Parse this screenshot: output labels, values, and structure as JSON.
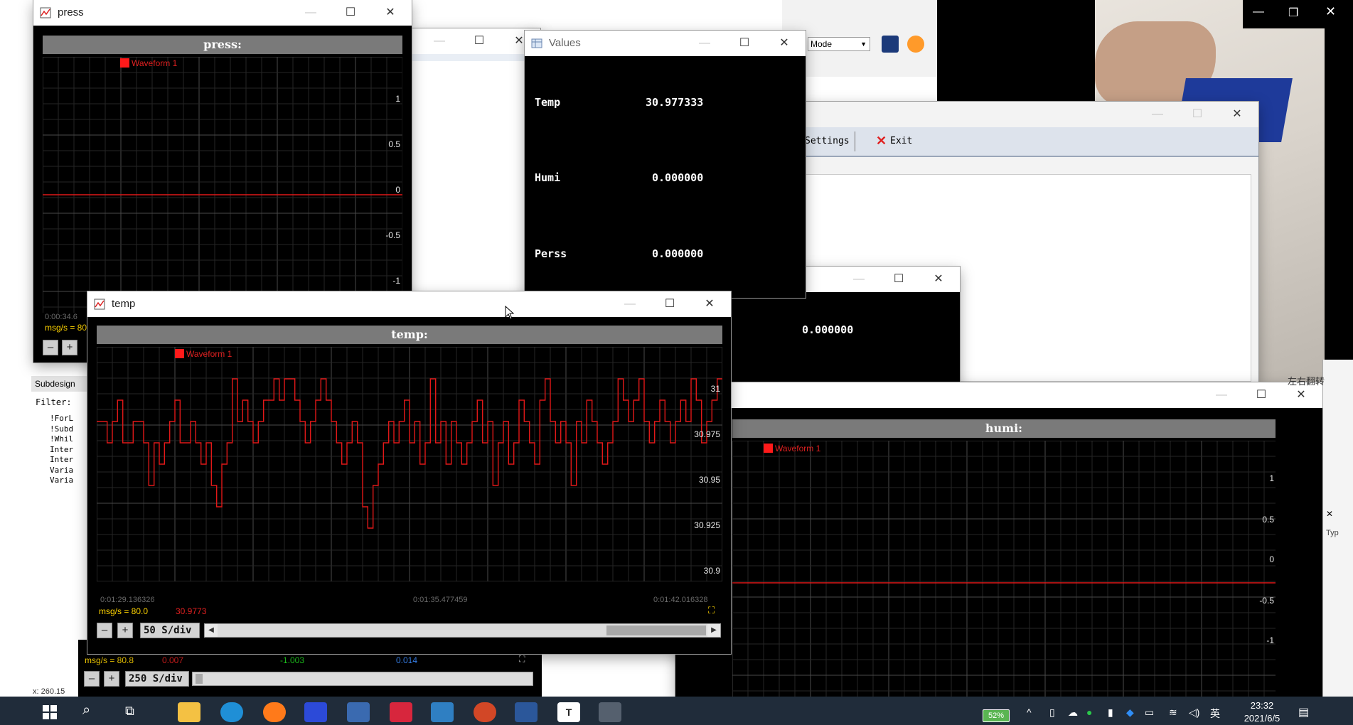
{
  "press_window": {
    "title": "press",
    "plot_title": "press:",
    "legend": "Waveform 1",
    "ticks": [
      "1",
      "0.5",
      "0",
      "-0.5",
      "-1"
    ],
    "timestamp": "0:00:34.6",
    "msg_rate": "msg/s = 80",
    "minus": "–",
    "plus": "+"
  },
  "values_window": {
    "title": "Values",
    "rows": [
      {
        "label": "Temp",
        "value": "30.977333"
      },
      {
        "label": "Humi",
        "value": "0.000000"
      },
      {
        "label": "Perss",
        "value": "0.000000"
      }
    ]
  },
  "temp_window": {
    "title": "temp",
    "plot_title": "temp:",
    "legend": "Waveform 1",
    "ticks": [
      "31",
      "30.975",
      "30.95",
      "30.925",
      "30.9"
    ],
    "time_left": "0:01:29.136326",
    "time_mid": "0:01:35.477459",
    "time_right": "0:01:42.016328",
    "msg_rate": "msg/s = 80.0",
    "current_value": "30.9773",
    "minus": "–",
    "plus": "+",
    "sdiv": "50 S/div"
  },
  "humi_window": {
    "plot_title": "humi:",
    "legend": "Waveform 1",
    "ticks": [
      "1",
      "0.5",
      "0",
      "-0.5",
      "-1"
    ]
  },
  "back_window": {
    "value": "0.000000"
  },
  "toolbar_window": {
    "mode_select": "Mode",
    "settings": "Settings",
    "exit": "Exit"
  },
  "left_panel": {
    "tab": "Subdesign",
    "filter_label": "Filter:",
    "items": [
      "!ForL",
      "!Subd",
      "!Whil",
      "Inter",
      "Inter",
      "Varia",
      "Varia"
    ],
    "coords": "x: 260.15"
  },
  "bottom_plot_bar": {
    "msg_rate": "msg/s = 80.8",
    "v1": "0.007",
    "v2": "-1.003",
    "v3": "0.014",
    "minus": "–",
    "plus": "+",
    "sdiv": "250 S/div"
  },
  "right_peek": {
    "text": "左右翻转",
    "typ": "Typ"
  },
  "taskbar": {
    "battery": "52%",
    "ime": "英",
    "time": "23:32",
    "date": "2021/6/5"
  },
  "colors": {
    "waveform": "#e01818",
    "plot_bg": "#000000",
    "grid": "#2a2a2a",
    "taskbar": "#202c3a"
  },
  "chart_data": [
    {
      "type": "line",
      "title": "temp:",
      "series": [
        {
          "name": "Waveform 1",
          "values": [
            30.965,
            30.965,
            30.955,
            30.965,
            30.975,
            30.955,
            30.955,
            30.965,
            30.965,
            30.955,
            30.935,
            30.955,
            30.945,
            30.955,
            30.965,
            30.975,
            30.955,
            30.955,
            30.965,
            30.955,
            30.945,
            30.955,
            30.935,
            30.925,
            30.945,
            30.955,
            30.985,
            30.965,
            30.975,
            30.965,
            30.955,
            30.965,
            30.975,
            30.975,
            30.985,
            30.975,
            30.985,
            30.985,
            30.975,
            30.965,
            30.955,
            30.965,
            30.975,
            30.985,
            30.975,
            30.965,
            30.955,
            30.945,
            30.955,
            30.965,
            30.955,
            30.925,
            30.915,
            30.935,
            30.945,
            30.955,
            30.965,
            30.955,
            30.965,
            30.975,
            30.955,
            30.965,
            30.945,
            30.955,
            30.985,
            30.955,
            30.965,
            30.945,
            30.965,
            30.955,
            30.945,
            30.955,
            30.965,
            30.975,
            30.955,
            30.965,
            30.935,
            30.955,
            30.965,
            30.945,
            30.955,
            30.975,
            30.965,
            30.955,
            30.945,
            30.975,
            30.985,
            30.965,
            30.955,
            30.965,
            30.955,
            30.935,
            30.965,
            30.955,
            30.975,
            30.965,
            30.955,
            30.945,
            30.955,
            30.965,
            30.985,
            30.975,
            30.965,
            30.975,
            30.985,
            30.965,
            30.955,
            30.965,
            30.975,
            30.965,
            30.955,
            30.965,
            30.975,
            30.965,
            30.985,
            30.975,
            30.955,
            30.965,
            30.975,
            30.985
          ]
        }
      ],
      "ylim": [
        30.89,
        31.0
      ],
      "y_ticks": [
        31,
        30.975,
        30.95,
        30.925,
        30.9
      ],
      "x_ticks": [
        "0:01:29.136326",
        "0:01:35.477459",
        "0:01:42.016328"
      ],
      "grid": true,
      "legend": "top-left"
    },
    {
      "type": "line",
      "title": "press:",
      "series": [
        {
          "name": "Waveform 1",
          "values": [
            0,
            0
          ]
        }
      ],
      "ylim": [
        -1,
        1
      ],
      "y_ticks": [
        1,
        0.5,
        0,
        -0.5,
        -1
      ],
      "grid": true
    },
    {
      "type": "line",
      "title": "humi:",
      "series": [
        {
          "name": "Waveform 1",
          "values": [
            0,
            0
          ]
        }
      ],
      "ylim": [
        -1,
        1
      ],
      "y_ticks": [
        1,
        0.5,
        0,
        -0.5,
        -1
      ],
      "grid": true
    }
  ]
}
